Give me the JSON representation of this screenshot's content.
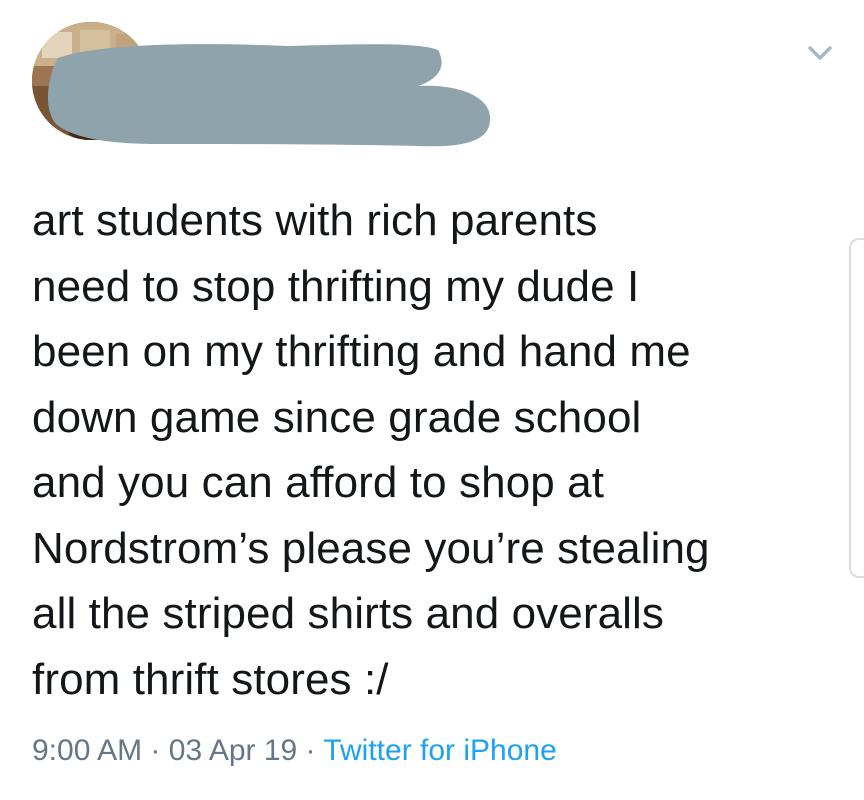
{
  "tweet": {
    "text": "art students with rich parents\nneed to stop thrifting my dude I\nbeen on my thrifting and hand me\ndown game since grade school\nand you can afford to shop at\nNordstrom’s please you’re stealing\nall the striped shirts and overalls\nfrom thrift stores :/",
    "time": "9:00 AM",
    "separator": "·",
    "date": "03 Apr 19",
    "source": "Twitter for iPhone"
  },
  "icons": {
    "menu": "chevron-down-icon",
    "avatar": "avatar-image",
    "redaction": "redaction-overlay"
  },
  "colors": {
    "text": "#14171a",
    "meta": "#657786",
    "link": "#1da1f2",
    "redaction": "#8fa3ac"
  }
}
